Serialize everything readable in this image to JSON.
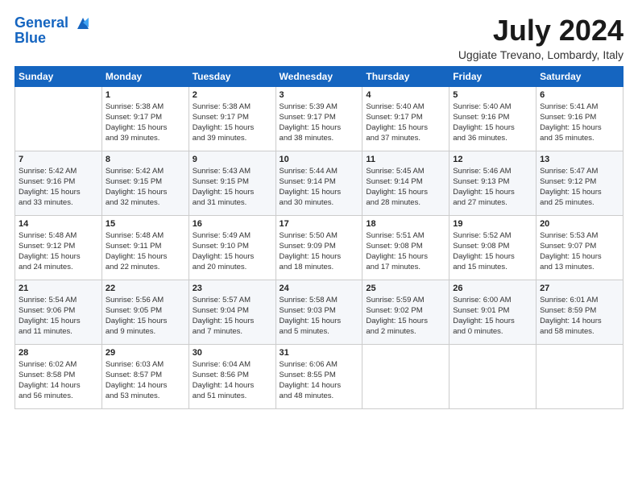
{
  "header": {
    "logo_line1": "General",
    "logo_line2": "Blue",
    "title": "July 2024",
    "subtitle": "Uggiate Trevano, Lombardy, Italy"
  },
  "days_of_week": [
    "Sunday",
    "Monday",
    "Tuesday",
    "Wednesday",
    "Thursday",
    "Friday",
    "Saturday"
  ],
  "weeks": [
    [
      {
        "num": "",
        "info": ""
      },
      {
        "num": "1",
        "info": "Sunrise: 5:38 AM\nSunset: 9:17 PM\nDaylight: 15 hours\nand 39 minutes."
      },
      {
        "num": "2",
        "info": "Sunrise: 5:38 AM\nSunset: 9:17 PM\nDaylight: 15 hours\nand 39 minutes."
      },
      {
        "num": "3",
        "info": "Sunrise: 5:39 AM\nSunset: 9:17 PM\nDaylight: 15 hours\nand 38 minutes."
      },
      {
        "num": "4",
        "info": "Sunrise: 5:40 AM\nSunset: 9:17 PM\nDaylight: 15 hours\nand 37 minutes."
      },
      {
        "num": "5",
        "info": "Sunrise: 5:40 AM\nSunset: 9:16 PM\nDaylight: 15 hours\nand 36 minutes."
      },
      {
        "num": "6",
        "info": "Sunrise: 5:41 AM\nSunset: 9:16 PM\nDaylight: 15 hours\nand 35 minutes."
      }
    ],
    [
      {
        "num": "7",
        "info": "Sunrise: 5:42 AM\nSunset: 9:16 PM\nDaylight: 15 hours\nand 33 minutes."
      },
      {
        "num": "8",
        "info": "Sunrise: 5:42 AM\nSunset: 9:15 PM\nDaylight: 15 hours\nand 32 minutes."
      },
      {
        "num": "9",
        "info": "Sunrise: 5:43 AM\nSunset: 9:15 PM\nDaylight: 15 hours\nand 31 minutes."
      },
      {
        "num": "10",
        "info": "Sunrise: 5:44 AM\nSunset: 9:14 PM\nDaylight: 15 hours\nand 30 minutes."
      },
      {
        "num": "11",
        "info": "Sunrise: 5:45 AM\nSunset: 9:14 PM\nDaylight: 15 hours\nand 28 minutes."
      },
      {
        "num": "12",
        "info": "Sunrise: 5:46 AM\nSunset: 9:13 PM\nDaylight: 15 hours\nand 27 minutes."
      },
      {
        "num": "13",
        "info": "Sunrise: 5:47 AM\nSunset: 9:12 PM\nDaylight: 15 hours\nand 25 minutes."
      }
    ],
    [
      {
        "num": "14",
        "info": "Sunrise: 5:48 AM\nSunset: 9:12 PM\nDaylight: 15 hours\nand 24 minutes."
      },
      {
        "num": "15",
        "info": "Sunrise: 5:48 AM\nSunset: 9:11 PM\nDaylight: 15 hours\nand 22 minutes."
      },
      {
        "num": "16",
        "info": "Sunrise: 5:49 AM\nSunset: 9:10 PM\nDaylight: 15 hours\nand 20 minutes."
      },
      {
        "num": "17",
        "info": "Sunrise: 5:50 AM\nSunset: 9:09 PM\nDaylight: 15 hours\nand 18 minutes."
      },
      {
        "num": "18",
        "info": "Sunrise: 5:51 AM\nSunset: 9:08 PM\nDaylight: 15 hours\nand 17 minutes."
      },
      {
        "num": "19",
        "info": "Sunrise: 5:52 AM\nSunset: 9:08 PM\nDaylight: 15 hours\nand 15 minutes."
      },
      {
        "num": "20",
        "info": "Sunrise: 5:53 AM\nSunset: 9:07 PM\nDaylight: 15 hours\nand 13 minutes."
      }
    ],
    [
      {
        "num": "21",
        "info": "Sunrise: 5:54 AM\nSunset: 9:06 PM\nDaylight: 15 hours\nand 11 minutes."
      },
      {
        "num": "22",
        "info": "Sunrise: 5:56 AM\nSunset: 9:05 PM\nDaylight: 15 hours\nand 9 minutes."
      },
      {
        "num": "23",
        "info": "Sunrise: 5:57 AM\nSunset: 9:04 PM\nDaylight: 15 hours\nand 7 minutes."
      },
      {
        "num": "24",
        "info": "Sunrise: 5:58 AM\nSunset: 9:03 PM\nDaylight: 15 hours\nand 5 minutes."
      },
      {
        "num": "25",
        "info": "Sunrise: 5:59 AM\nSunset: 9:02 PM\nDaylight: 15 hours\nand 2 minutes."
      },
      {
        "num": "26",
        "info": "Sunrise: 6:00 AM\nSunset: 9:01 PM\nDaylight: 15 hours\nand 0 minutes."
      },
      {
        "num": "27",
        "info": "Sunrise: 6:01 AM\nSunset: 8:59 PM\nDaylight: 14 hours\nand 58 minutes."
      }
    ],
    [
      {
        "num": "28",
        "info": "Sunrise: 6:02 AM\nSunset: 8:58 PM\nDaylight: 14 hours\nand 56 minutes."
      },
      {
        "num": "29",
        "info": "Sunrise: 6:03 AM\nSunset: 8:57 PM\nDaylight: 14 hours\nand 53 minutes."
      },
      {
        "num": "30",
        "info": "Sunrise: 6:04 AM\nSunset: 8:56 PM\nDaylight: 14 hours\nand 51 minutes."
      },
      {
        "num": "31",
        "info": "Sunrise: 6:06 AM\nSunset: 8:55 PM\nDaylight: 14 hours\nand 48 minutes."
      },
      {
        "num": "",
        "info": ""
      },
      {
        "num": "",
        "info": ""
      },
      {
        "num": "",
        "info": ""
      }
    ]
  ]
}
